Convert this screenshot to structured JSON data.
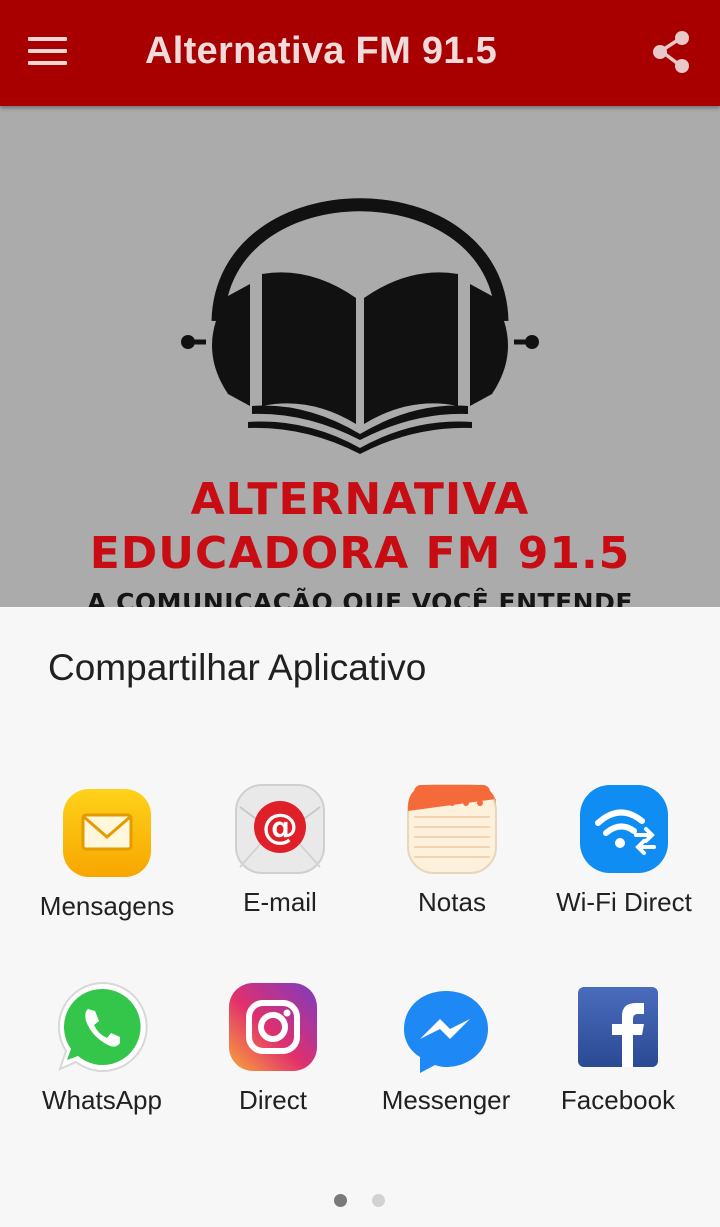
{
  "appbar": {
    "title": "Alternativa FM 91.5",
    "menu_icon": "hamburger-menu-icon",
    "share_icon": "share-icon"
  },
  "banner": {
    "logo_icon": "headphones-book-icon",
    "logo_line1": "ALTERNATIVA",
    "logo_line2": "EDUCADORA FM 91.5",
    "logo_line3": "A COMUNICAÇÃO QUE VOCÊ ENTENDE"
  },
  "share_sheet": {
    "title": "Compartilhar Aplicativo",
    "apps": [
      {
        "label": "Mensagens",
        "icon": "envelope-icon"
      },
      {
        "label": "E-mail",
        "icon": "email-at-icon"
      },
      {
        "label": "Notas",
        "icon": "notepad-icon"
      },
      {
        "label": "Wi-Fi Direct",
        "icon": "wifi-direct-icon"
      },
      {
        "label": "WhatsApp",
        "icon": "whatsapp-icon"
      },
      {
        "label": "Direct",
        "icon": "instagram-icon"
      },
      {
        "label": "Messenger",
        "icon": "messenger-icon"
      },
      {
        "label": "Facebook",
        "icon": "facebook-icon"
      }
    ],
    "pages": 2,
    "current_page": 1
  },
  "colors": {
    "appbar": "#a80000",
    "logo_red": "#c80c14",
    "sheet_bg": "#f7f7f7",
    "banner_bg": "#ababab"
  }
}
